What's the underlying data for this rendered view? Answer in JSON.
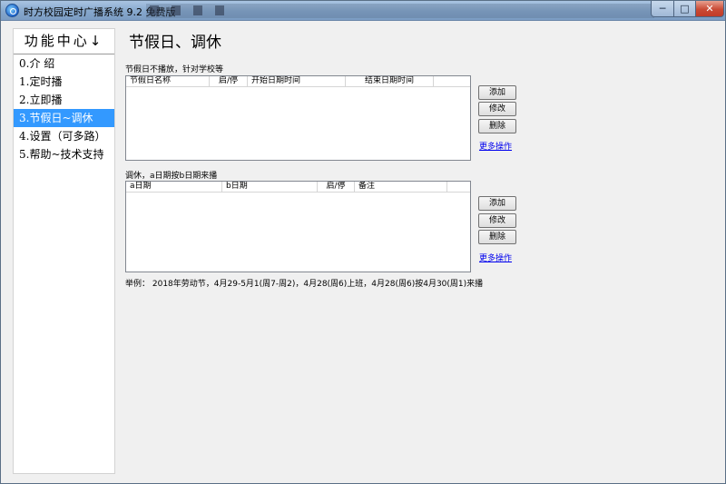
{
  "window": {
    "title": "时方校园定时广播系统 9.2 免费版",
    "controls": {
      "minimize": "─",
      "maximize": "□",
      "close": "✕"
    }
  },
  "sidebar": {
    "header": "功能中心",
    "header_arrow": "↓",
    "items": [
      {
        "label": "0.介 绍"
      },
      {
        "label": "1.定时播"
      },
      {
        "label": "2.立即播"
      },
      {
        "label": "3.节假日~调休",
        "selected": true
      },
      {
        "label": "4.设置（可多路）"
      },
      {
        "label": "5.帮助~技术支持"
      }
    ]
  },
  "main": {
    "title": "节假日、调休",
    "holiday": {
      "label": "节假日不播放，针对学校等",
      "columns": [
        "节假日名称",
        "启/停",
        "开始日期时间",
        "结束日期时间"
      ],
      "buttons": {
        "add": "添加",
        "edit": "修改",
        "delete": "删除"
      },
      "more": "更多操作"
    },
    "swap": {
      "label": "调休，a日期按b日期来播",
      "columns": [
        "a日期",
        "b日期",
        "启/停",
        "备注"
      ],
      "buttons": {
        "add": "添加",
        "edit": "修改",
        "delete": "删除"
      },
      "more": "更多操作"
    },
    "example": "举例： 2018年劳动节，4月29-5月1(周7-周2)，4月28(周6)上班，4月28(周6)按4月30(周1)来播"
  }
}
